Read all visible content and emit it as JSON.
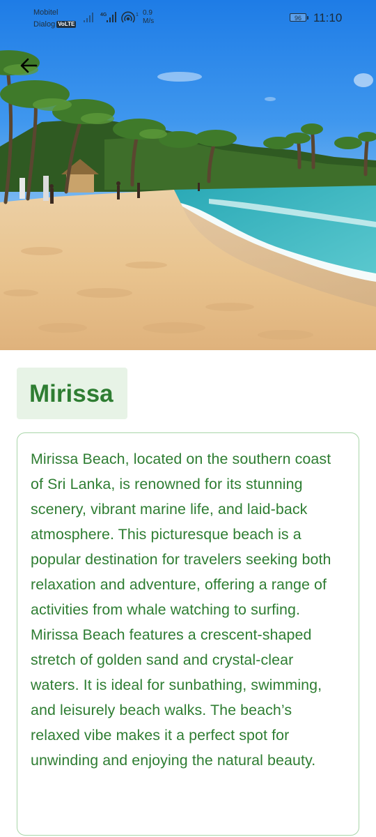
{
  "status_bar": {
    "carrier_1": "Mobitel",
    "carrier_2": "Dialog",
    "volte_badge": "VoLTE",
    "network_type": "4G",
    "speed_value": "0.9",
    "speed_unit": "M/s",
    "battery_level": "96",
    "time": "11:10"
  },
  "header": {
    "back_icon": "arrow-left-icon"
  },
  "place": {
    "title": "Mirissa",
    "description": "Mirissa Beach, located on the southern coast of Sri Lanka, is renowned for its stunning scenery, vibrant marine life, and laid-back atmosphere. This picturesque beach is a popular destination for travelers seeking both relaxation and adventure, offering a range of activities from whale watching to surfing. Mirissa Beach features a crescent-shaped stretch of golden sand and crystal-clear waters. It is ideal for sunbathing, swimming, and leisurely beach walks. The beach’s relaxed vibe makes it a perfect spot for unwinding and enjoying the natural beauty."
  },
  "colors": {
    "accent_green": "#2e7d32",
    "chip_background": "#e7f3e6",
    "card_border": "#a8d5a8"
  }
}
